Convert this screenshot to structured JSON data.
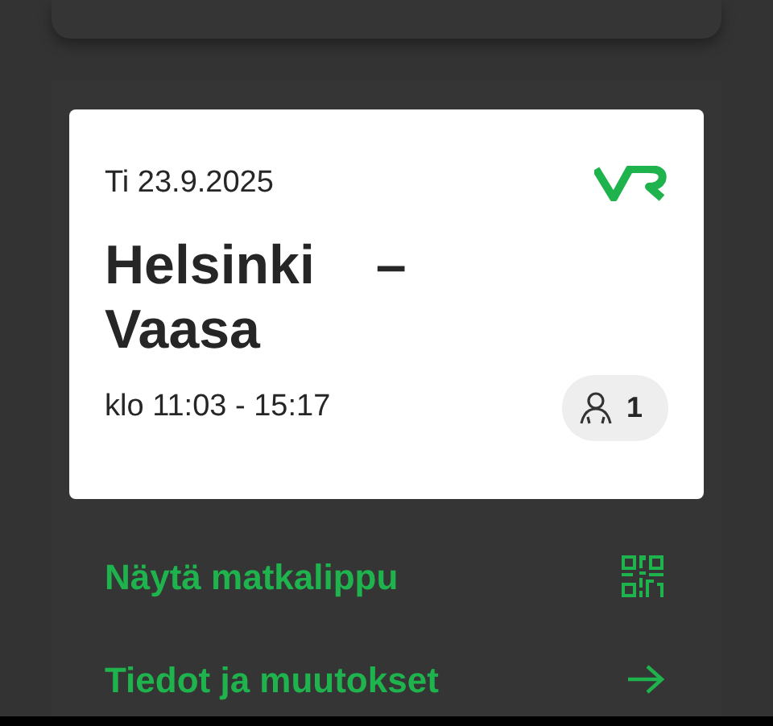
{
  "ticket": {
    "date": "Ti 23.9.2025",
    "origin": "Helsinki",
    "separator": "–",
    "destination": "Vaasa",
    "time": "klo 11:03 - 15:17",
    "passengers": "1"
  },
  "actions": [
    {
      "label": "Näytä matkalippu",
      "kind": "qr"
    },
    {
      "label": "Tiedot ja muutokset",
      "kind": "arrow"
    }
  ]
}
